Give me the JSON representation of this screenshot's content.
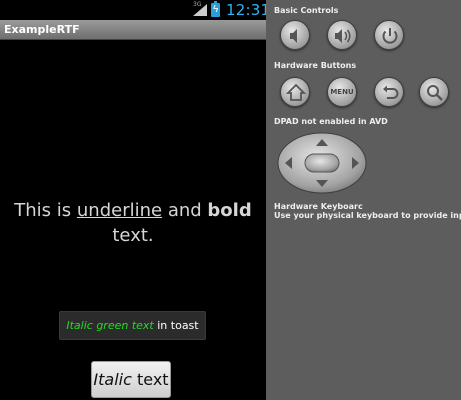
{
  "status_bar": {
    "network": "3G",
    "time": "12:31",
    "battery_color": "#2a9fd6",
    "clock_color": "#2fb3f0"
  },
  "app": {
    "title": "ExampleRTF",
    "rich_text": {
      "part1": "This is ",
      "underline": "underline",
      "part2": " and ",
      "bold": "bold",
      "part3": "text."
    },
    "toast": {
      "green_italic": "Italic green text",
      "rest": " in toast",
      "green_color": "#22dd22"
    },
    "button": {
      "italic": "Italic",
      "rest": " text"
    }
  },
  "emulator_panel": {
    "basic_controls_label": "Basic Controls",
    "basic_controls": [
      "volume-down-icon",
      "volume-up-icon",
      "power-icon"
    ],
    "hardware_buttons_label": "Hardware Buttons",
    "hardware_buttons": [
      "home-icon",
      "menu-button",
      "back-icon",
      "search-icon"
    ],
    "menu_label": "MENU",
    "dpad_label": "DPAD not enabled in AVD",
    "keyboard_label": "Hardware Keyboarc",
    "keyboard_hint": "Use your physical keyboard to provide input"
  }
}
